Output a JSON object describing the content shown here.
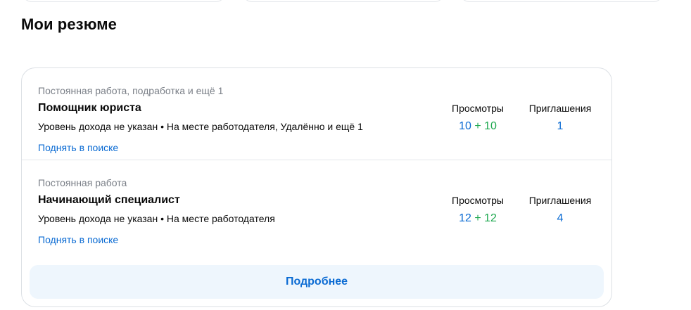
{
  "section": {
    "title": "Мои резюме"
  },
  "resumes": [
    {
      "employment": "Постоянная работа, подработка и ещё 1",
      "title": "Помощник юриста",
      "info": "Уровень дохода не указан • На месте работодателя, Удалённо и ещё 1",
      "raise_link": "Поднять в поиске",
      "views_label": "Просмотры",
      "views_total": "10",
      "views_plus": "+ 10",
      "invites_label": "Приглашения",
      "invites_value": "1"
    },
    {
      "employment": "Постоянная работа",
      "title": "Начинающий специалист",
      "info": "Уровень дохода не указан • На месте работодателя",
      "raise_link": "Поднять в поиске",
      "views_label": "Просмотры",
      "views_total": "12",
      "views_plus": "+ 12",
      "invites_label": "Приглашения",
      "invites_value": "4"
    }
  ],
  "more_button": "Подробнее",
  "colors": {
    "link": "#0b6bd3",
    "new_views": "#1ea84f",
    "button_bg": "#eef6fd"
  }
}
